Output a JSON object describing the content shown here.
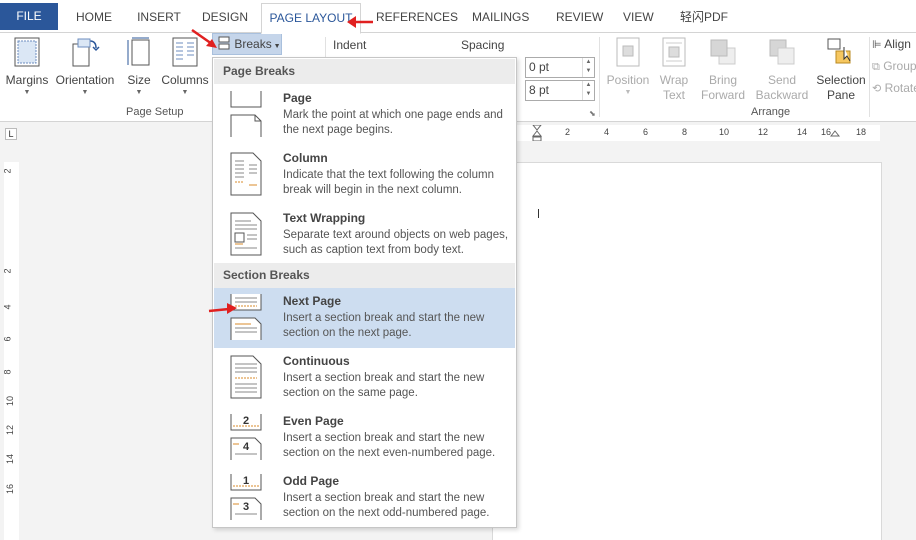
{
  "tabs": [
    {
      "label": "FILE"
    },
    {
      "label": "HOME"
    },
    {
      "label": "INSERT"
    },
    {
      "label": "DESIGN"
    },
    {
      "label": "PAGE LAYOUT"
    },
    {
      "label": "REFERENCES"
    },
    {
      "label": "MAILINGS"
    },
    {
      "label": "REVIEW"
    },
    {
      "label": "VIEW"
    },
    {
      "label": "轻闪PDF"
    }
  ],
  "ribbon": {
    "margins": "Margins",
    "orientation": "Orientation",
    "size": "Size",
    "columns": "Columns",
    "breaks": "Breaks",
    "page_setup": "Page Setup",
    "indent": "Indent",
    "spacing": "Spacing",
    "spacing_before": "0 pt",
    "spacing_after": "8 pt",
    "position": "Position",
    "wrap_text_1": "Wrap",
    "wrap_text_2": "Text",
    "bring_forward_1": "Bring",
    "bring_forward_2": "Forward",
    "send_backward_1": "Send",
    "send_backward_2": "Backward",
    "selection_pane_1": "Selection",
    "selection_pane_2": "Pane",
    "arrange": "Arrange",
    "align": "Align",
    "group": "Group",
    "rotate": "Rotate"
  },
  "ruler": {
    "corner": "L",
    "h_ticks": [
      "2",
      "4",
      "6",
      "8",
      "10",
      "12",
      "14",
      "16",
      "18"
    ],
    "v_ticks": [
      "2",
      "2",
      "4",
      "6",
      "8",
      "10",
      "12",
      "14",
      "16"
    ]
  },
  "breaks_menu": {
    "page_breaks_heading": "Page Breaks",
    "section_breaks_heading": "Section Breaks",
    "items": [
      {
        "title": "Page",
        "desc": "Mark the point at which one page ends and the next page begins."
      },
      {
        "title": "Column",
        "desc": "Indicate that the text following the column break will begin in the next column."
      },
      {
        "title": "Text Wrapping",
        "desc": "Separate text around objects on web pages, such as caption text from body text."
      },
      {
        "title": "Next Page",
        "desc": "Insert a section break and start the new section on the next page."
      },
      {
        "title": "Continuous",
        "desc": "Insert a section break and start the new section on the same page."
      },
      {
        "title": "Even Page",
        "desc": "Insert a section break and start the new section on the next even-numbered page.",
        "icon_number_top": "2",
        "icon_number_bottom": "4"
      },
      {
        "title": "Odd Page",
        "desc": "Insert a section break and start the new section on the next odd-numbered page.",
        "icon_number_top": "1",
        "icon_number_bottom": "3"
      }
    ]
  },
  "colors": {
    "accent": "#2b579a",
    "highlight": "#cdddf0",
    "annotation_arrow": "#e02020"
  }
}
